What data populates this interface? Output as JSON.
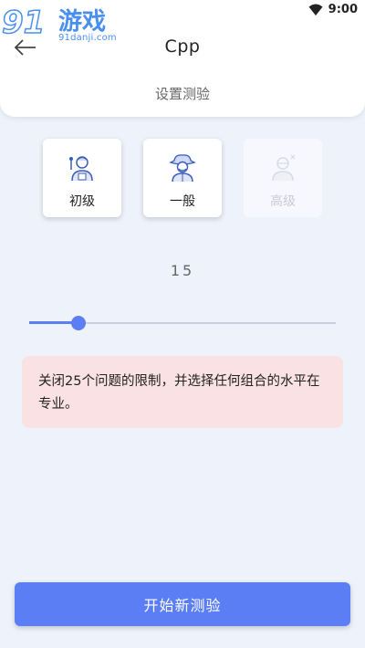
{
  "status_bar": {
    "time": "9:00",
    "wifi_icon": "wifi-icon"
  },
  "watermark": {
    "logo_text": "91游戏",
    "site": "91danji.com"
  },
  "header": {
    "title": "Cpp",
    "subtitle": "设置测验",
    "back_icon": "arrow-left-icon"
  },
  "levels": [
    {
      "label": "初级",
      "icon": "beginner-avatar-icon",
      "enabled": true
    },
    {
      "label": "一般",
      "icon": "cowboy-avatar-icon",
      "enabled": true
    },
    {
      "label": "高级",
      "icon": "expert-avatar-icon",
      "enabled": false
    }
  ],
  "question_count": {
    "value": "15",
    "slider_fraction": 0.16
  },
  "info": {
    "text": "关闭25个问题的限制，并选择任何组合的水平在专业。"
  },
  "start_button": {
    "label": "开始新测验"
  },
  "colors": {
    "accent": "#5b7ef5",
    "info_bg": "#fae1e3",
    "page_bg": "#eef2fb"
  }
}
